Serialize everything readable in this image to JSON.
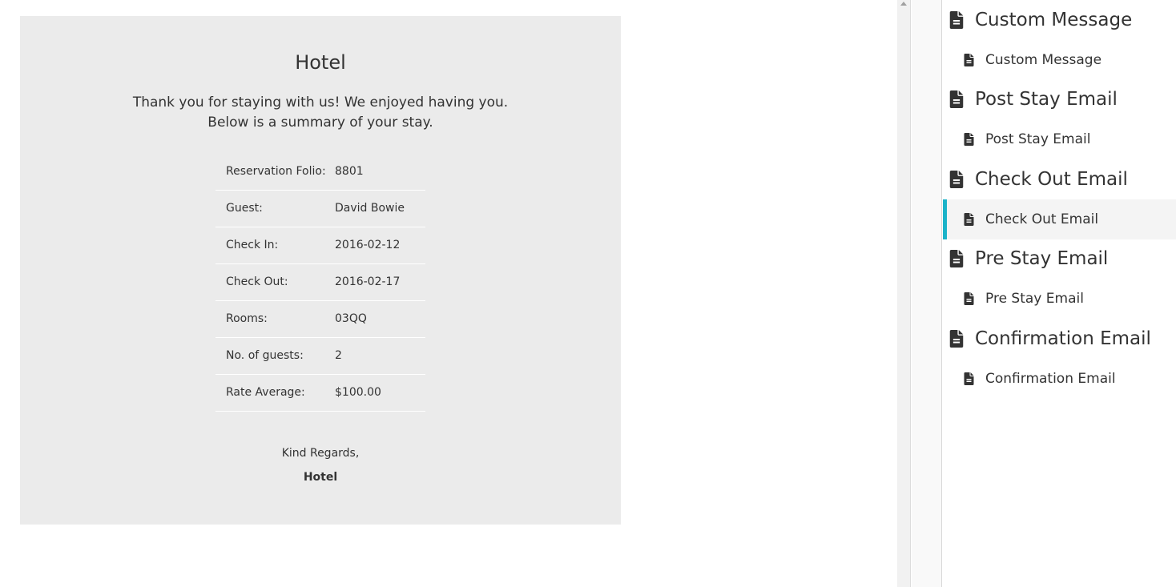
{
  "email": {
    "hotel_name": "Hotel",
    "intro_line1": "Thank you for staying with us! We enjoyed having you.",
    "intro_line2": "Below is a summary of your stay.",
    "summary_rows": [
      {
        "label": "Reservation Folio:",
        "value": "8801"
      },
      {
        "label": "Guest:",
        "value": "David Bowie"
      },
      {
        "label": "Check In:",
        "value": "2016-02-12"
      },
      {
        "label": "Check Out:",
        "value": "2016-02-17"
      },
      {
        "label": "Rooms:",
        "value": "03QQ"
      },
      {
        "label": "No. of guests:",
        "value": "2"
      },
      {
        "label": "Rate Average:",
        "value": "$100.00"
      }
    ],
    "closing": "Kind Regards,",
    "signature": "Hotel"
  },
  "sidebar": {
    "accent_color": "#1ab3c9",
    "groups": [
      {
        "title": "Custom Message",
        "item": "Custom Message",
        "icon": "file-icon",
        "active": false
      },
      {
        "title": "Post Stay Email",
        "item": "Post Stay Email",
        "icon": "file-icon",
        "active": false
      },
      {
        "title": "Check Out Email",
        "item": "Check Out Email",
        "icon": "file-icon",
        "active": true
      },
      {
        "title": "Pre Stay Email",
        "item": "Pre Stay Email",
        "icon": "file-icon",
        "active": false
      },
      {
        "title": "Confirmation Email",
        "item": "Confirmation Email",
        "icon": "file-icon",
        "active": false
      }
    ]
  }
}
